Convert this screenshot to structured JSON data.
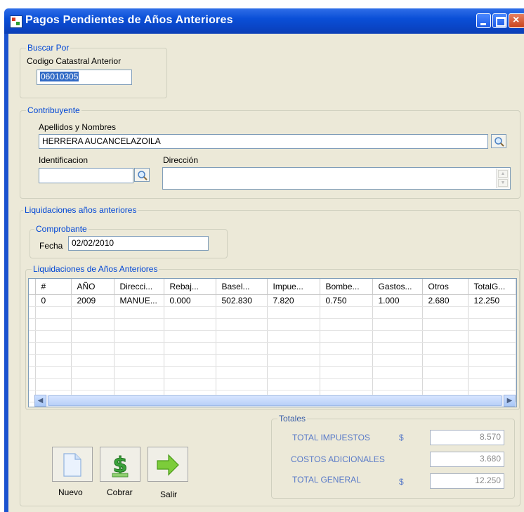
{
  "window": {
    "title": "Pagos Pendientes de Años Anteriores"
  },
  "buscar": {
    "group_label": "Buscar Por",
    "field_label": "Codigo Catastral Anterior",
    "value": "06010305"
  },
  "contribuyente": {
    "group_label": "Contribuyente",
    "nombres_label": "Apellidos y Nombres",
    "nombres_value": "HERRERA AUCANCELAZOILA",
    "identificacion_label": "Identificacion",
    "identificacion_value": "",
    "direccion_label": "Dirección",
    "direccion_value": ""
  },
  "liquidaciones": {
    "group_label": "Liquidaciones años anteriores",
    "comprobante_label": "Comprobante",
    "fecha_label": "Fecha",
    "fecha_value": "02/02/2010",
    "grid_label": "Liquidaciones de Años Anteriores",
    "columns": [
      "#",
      "AÑO",
      "Direcci...",
      "Rebaj...",
      "Basel...",
      "Impue...",
      "Bombe...",
      "Gastos...",
      "Otros",
      "TotalG..."
    ],
    "rows": [
      [
        "0",
        "2009",
        "MANUE...",
        "0.000",
        "502.830",
        "7.820",
        "0.750",
        "1.000",
        "2.680",
        "12.250"
      ]
    ]
  },
  "totales": {
    "group_label": "Totales",
    "impuestos_label": "TOTAL IMPUESTOS",
    "impuestos_currency": "$",
    "impuestos_value": "8.570",
    "costos_label": "COSTOS ADICIONALES",
    "costos_value": "3.680",
    "general_label": "TOTAL GENERAL",
    "general_currency": "$",
    "general_value": "12.250"
  },
  "actions": {
    "nuevo": "Nuevo",
    "cobrar": "Cobrar",
    "salir": "Salir"
  },
  "icons": {
    "search": "magnifier-icon",
    "nuevo": "blank-document-icon",
    "cobrar": "dollar-icon",
    "salir": "right-arrow-icon"
  }
}
